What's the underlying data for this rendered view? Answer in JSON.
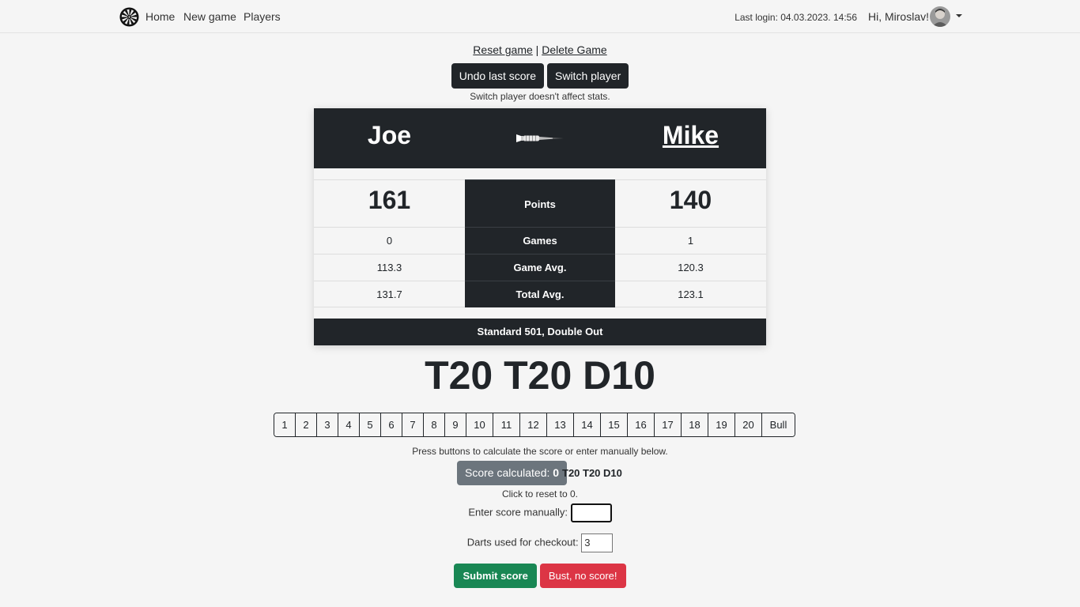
{
  "nav": {
    "home": "Home",
    "new_game": "New game",
    "players": "Players",
    "last_login": "Last login: 04.03.2023. 14:56",
    "greeting": "Hi, Miroslav!"
  },
  "actions": {
    "reset_game": "Reset game",
    "separator": "|",
    "delete_game": "Delete Game",
    "undo": "Undo last score",
    "switch": "Switch player",
    "switch_note": "Switch player doesn't affect stats."
  },
  "scoreboard": {
    "player1": "Joe",
    "player2": "Mike",
    "rows": [
      {
        "label": "Points",
        "p1": "161",
        "p2": "140"
      },
      {
        "label": "Games",
        "p1": "0",
        "p2": "1"
      },
      {
        "label": "Game Avg.",
        "p1": "113.3",
        "p2": "120.3"
      },
      {
        "label": "Total Avg.",
        "p1": "131.7",
        "p2": "123.1"
      }
    ],
    "mode": "Standard 501, Double Out"
  },
  "throw_display": "T20 T20 D10",
  "numpad": [
    "1",
    "2",
    "3",
    "4",
    "5",
    "6",
    "7",
    "8",
    "9",
    "10",
    "11",
    "12",
    "13",
    "14",
    "15",
    "16",
    "17",
    "18",
    "19",
    "20",
    "Bull"
  ],
  "calc": {
    "instructions": "Press buttons to calculate the score or enter manually below.",
    "button_label": "Score calculated: ",
    "button_value": "0",
    "throws": "T20 T20 D10",
    "reset_hint": "Click to reset to 0."
  },
  "form": {
    "manual_label": "Enter score manually:",
    "manual_value": "",
    "darts_label": "Darts used for checkout:",
    "darts_value": "3"
  },
  "submit": {
    "submit_label": "Submit score",
    "bust_label": "Bust, no score!"
  },
  "colors": {
    "dark": "#212529",
    "success": "#198754",
    "danger": "#dc3545",
    "secondary": "#6c757d"
  }
}
